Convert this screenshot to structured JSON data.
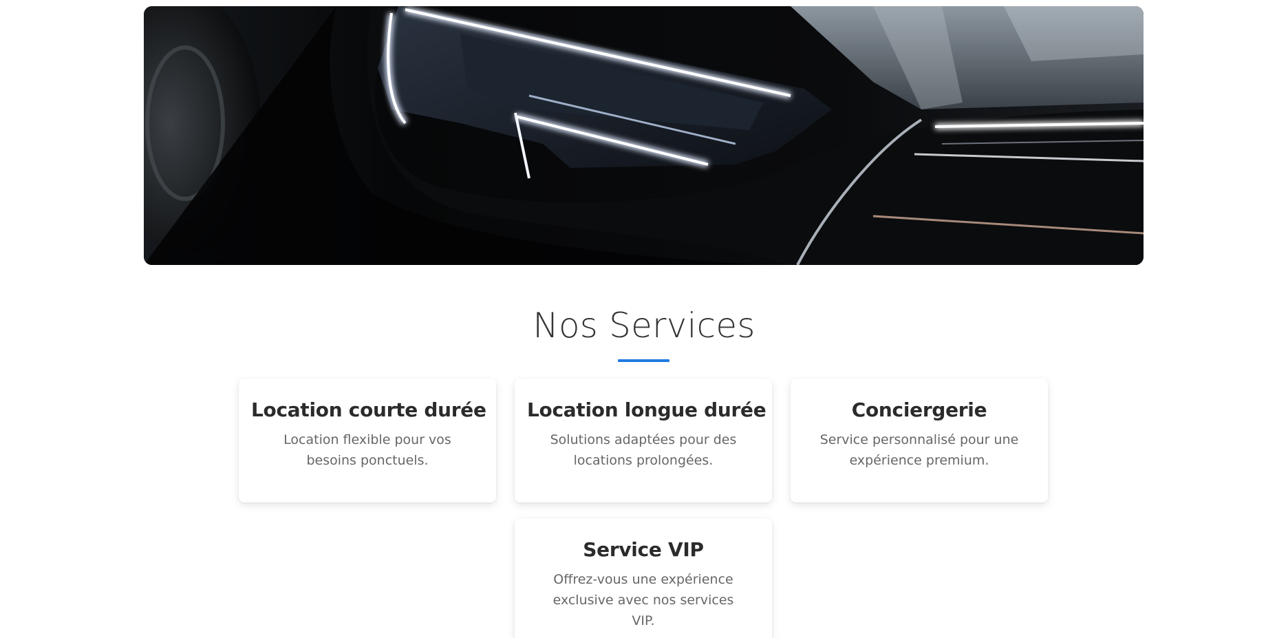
{
  "hero": {
    "image_icon": "car-headlight-image"
  },
  "services": {
    "title": "Nos Services",
    "accent_color": "#1f7ae0",
    "cards": [
      {
        "title": "Location courte durée",
        "text": "Location flexible pour vos besoins ponctuels."
      },
      {
        "title": "Location longue durée",
        "text": "Solutions adaptées pour des locations prolongées."
      },
      {
        "title": "Conciergerie",
        "text": "Service personnalisé pour une expérience premium."
      },
      {
        "title": "Service VIP",
        "text": "Offrez-vous une expérience exclusive avec nos services VIP."
      }
    ]
  }
}
